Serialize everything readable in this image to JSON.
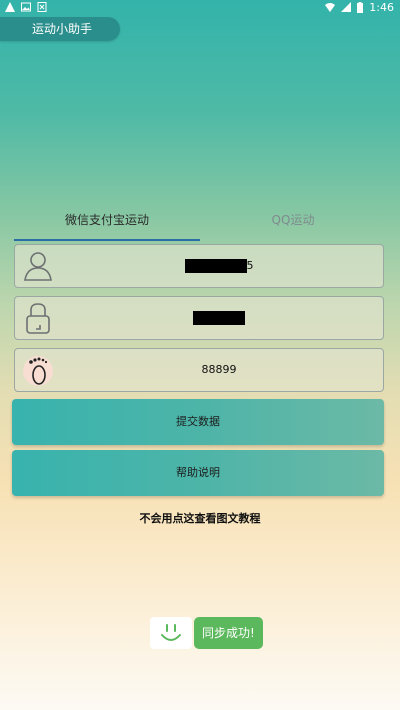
{
  "status_bar": {
    "time": "1:46",
    "left_icons": [
      "warning-icon",
      "image-icon",
      "download-icon"
    ],
    "right_icons": [
      "wifi-icon",
      "signal-icon",
      "battery-icon"
    ]
  },
  "app": {
    "title": "运动小助手"
  },
  "tabs": [
    {
      "label": "微信支付宝运动",
      "active": true
    },
    {
      "label": "QQ运动",
      "active": false
    }
  ],
  "form": {
    "account": {
      "visible_suffix": "5",
      "icon": "user-icon"
    },
    "password": {
      "icon": "lock-icon"
    },
    "steps": {
      "value": "88899",
      "icon": "footprint-icon"
    }
  },
  "buttons": {
    "submit": "提交数据",
    "help": "帮助说明"
  },
  "help_link": "不会用点这查看图文教程",
  "toast": {
    "message": "同步成功!",
    "icon": "smiley-icon"
  },
  "colors": {
    "primary": "#2a8f8c",
    "button": "#43b3ab",
    "tab_underline": "#2a6ea6",
    "toast": "#5cb85c"
  }
}
